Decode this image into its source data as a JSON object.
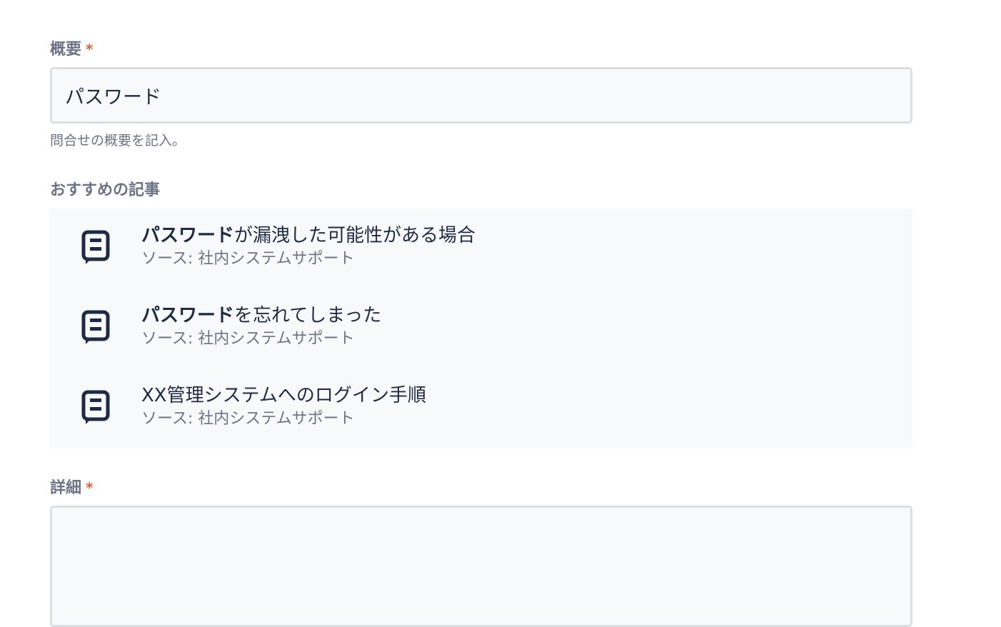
{
  "summary": {
    "label": "概要",
    "required_mark": "*",
    "value": "パスワード",
    "hint": "問合せの概要を記入。"
  },
  "suggestions": {
    "heading": "おすすめの記事",
    "items": [
      {
        "title_highlight": "パスワード",
        "title_rest": "が漏洩した可能性がある場合",
        "source": "ソース: 社内システムサポート",
        "icon": "article-icon"
      },
      {
        "title_highlight": "パスワード",
        "title_rest": "を忘れてしまった",
        "source": "ソース: 社内システムサポート",
        "icon": "article-icon"
      },
      {
        "title_highlight": "",
        "title_rest": "XX管理システムへのログイン手順",
        "source": "ソース: 社内システムサポート",
        "icon": "article-icon"
      }
    ]
  },
  "detail": {
    "label": "詳細",
    "required_mark": "*",
    "value": ""
  },
  "colors": {
    "required": "#e0623a",
    "label": "#6b7385",
    "text": "#1f2a44",
    "field_bg": "#f8f9fb",
    "field_border": "#dcdee2"
  }
}
